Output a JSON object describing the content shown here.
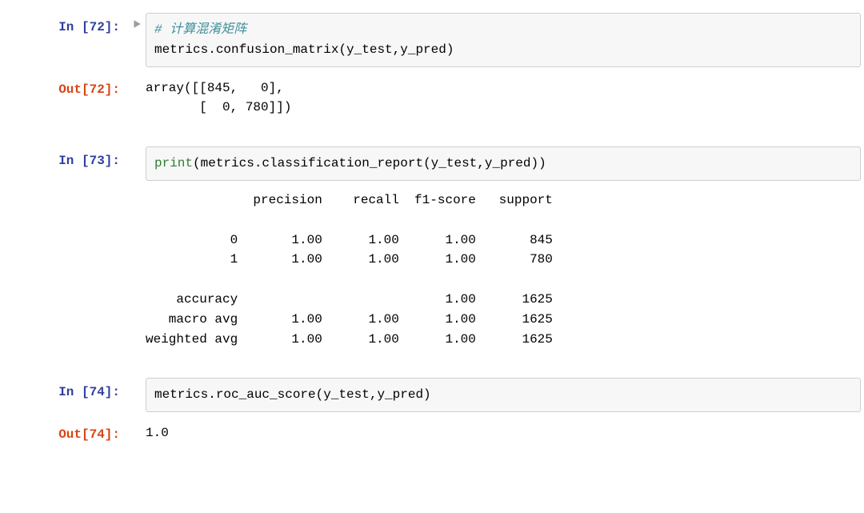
{
  "cells": {
    "c72": {
      "in_label": "In [72]:",
      "out_label": "Out[72]:",
      "code_comment": "# 计算混淆矩阵",
      "code_line2": "metrics.confusion_matrix(y_test,y_pred)",
      "output": "array([[845,   0],\n       [  0, 780]])"
    },
    "c73": {
      "in_label": "In [73]:",
      "code_fn": "print",
      "code_rest": "(metrics.classification_report(y_test,y_pred))",
      "output": "              precision    recall  f1-score   support\n\n           0       1.00      1.00      1.00       845\n           1       1.00      1.00      1.00       780\n\n    accuracy                           1.00      1625\n   macro avg       1.00      1.00      1.00      1625\nweighted avg       1.00      1.00      1.00      1625\n"
    },
    "c74": {
      "in_label": "In [74]:",
      "out_label": "Out[74]:",
      "code": "metrics.roc_auc_score(y_test,y_pred)",
      "output": "1.0"
    }
  }
}
